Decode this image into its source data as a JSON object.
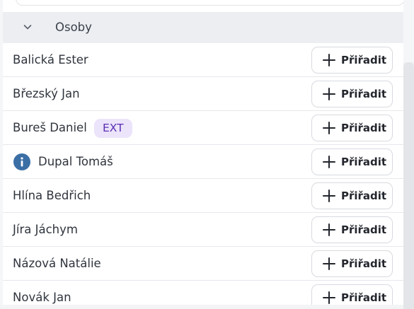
{
  "group": {
    "title": "Osoby",
    "expanded": true,
    "icon": "chevron-down-icon"
  },
  "assign_label": "Přiřadit",
  "people": [
    {
      "name": "Balická Ester",
      "badge": "",
      "info": false
    },
    {
      "name": "Březský Jan",
      "badge": "",
      "info": false
    },
    {
      "name": "Bureš Daniel",
      "badge": "EXT",
      "info": false
    },
    {
      "name": "Dupal Tomáš",
      "badge": "",
      "info": true
    },
    {
      "name": "Hlína Bedřich",
      "badge": "",
      "info": false
    },
    {
      "name": "Jíra Jáchym",
      "badge": "",
      "info": false
    },
    {
      "name": "Názová Natálie",
      "badge": "",
      "info": false
    },
    {
      "name": "Novák Jan",
      "badge": "",
      "info": false
    }
  ],
  "colors": {
    "badge_bg": "#ece4fb",
    "badge_text": "#5b2fb4",
    "info_icon": "#3a6ea5",
    "header_bg": "#eceef2"
  }
}
